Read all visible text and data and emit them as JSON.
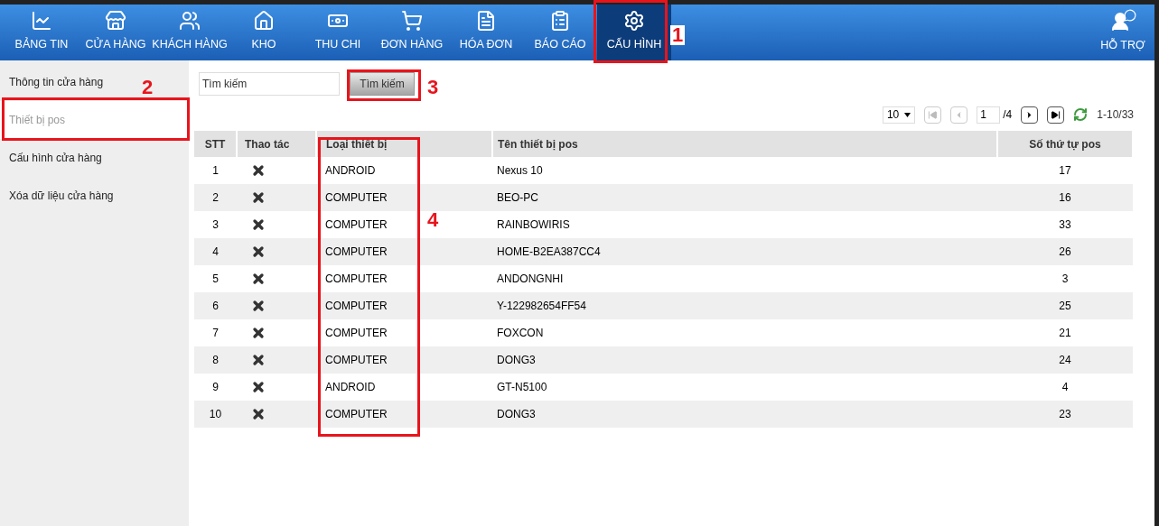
{
  "nav": {
    "items": [
      {
        "label": "BẢNG TIN",
        "selected": false
      },
      {
        "label": "CỬA HÀNG",
        "selected": false
      },
      {
        "label": "KHÁCH HÀNG",
        "selected": false
      },
      {
        "label": "KHO",
        "selected": false
      },
      {
        "label": "THU CHI",
        "selected": false
      },
      {
        "label": "ĐƠN HÀNG",
        "selected": false
      },
      {
        "label": "HÓA ĐƠN",
        "selected": false
      },
      {
        "label": "BÁO CÁO",
        "selected": false
      },
      {
        "label": "CẤU HÌNH",
        "selected": true
      }
    ],
    "support": {
      "label": "HỖ TRỢ"
    }
  },
  "sidebar": {
    "items": [
      {
        "label": "Thông tin cửa hàng",
        "selected": false
      },
      {
        "label": "Thiết bị pos",
        "selected": true
      },
      {
        "label": "Cấu hình cửa hàng",
        "selected": false
      },
      {
        "label": "Xóa dữ liệu cửa hàng",
        "selected": false
      }
    ]
  },
  "search": {
    "placeholder": "Tìm kiếm",
    "button": "Tìm kiếm"
  },
  "pager": {
    "page_size": "10",
    "buttons": [
      {
        "kind": "first",
        "disabled": true
      },
      {
        "kind": "prev",
        "disabled": true
      }
    ],
    "page": "1",
    "total_pages": "/4",
    "next_buttons": [
      {
        "kind": "next",
        "disabled": false
      },
      {
        "kind": "last",
        "disabled": false
      }
    ],
    "range": "1-10/33"
  },
  "table": {
    "columns": [
      "STT",
      "Thao tác",
      "Loại thiết bị",
      "Tên thiết bị pos",
      "Số thứ tự pos"
    ],
    "rows": [
      [
        "1",
        "",
        "ANDROID",
        "Nexus 10",
        "17"
      ],
      [
        "2",
        "",
        "COMPUTER",
        "BEO-PC",
        "16"
      ],
      [
        "3",
        "",
        "COMPUTER",
        "RAINBOWIRIS",
        "33"
      ],
      [
        "4",
        "",
        "COMPUTER",
        "HOME-B2EA387CC4",
        "26"
      ],
      [
        "5",
        "",
        "COMPUTER",
        "ANDONGNHI",
        "3"
      ],
      [
        "6",
        "",
        "COMPUTER",
        "Y-122982654FF54",
        "25"
      ],
      [
        "7",
        "",
        "COMPUTER",
        "FOXCON",
        "21"
      ],
      [
        "8",
        "",
        "COMPUTER",
        "DONG3",
        "24"
      ],
      [
        "9",
        "",
        "ANDROID",
        "GT-N5100",
        "4"
      ],
      [
        "10",
        "",
        "COMPUTER",
        "DONG3",
        "23"
      ]
    ]
  },
  "annotations": [
    {
      "label": "1"
    },
    {
      "label": "2"
    },
    {
      "label": "3"
    },
    {
      "label": "4"
    }
  ]
}
